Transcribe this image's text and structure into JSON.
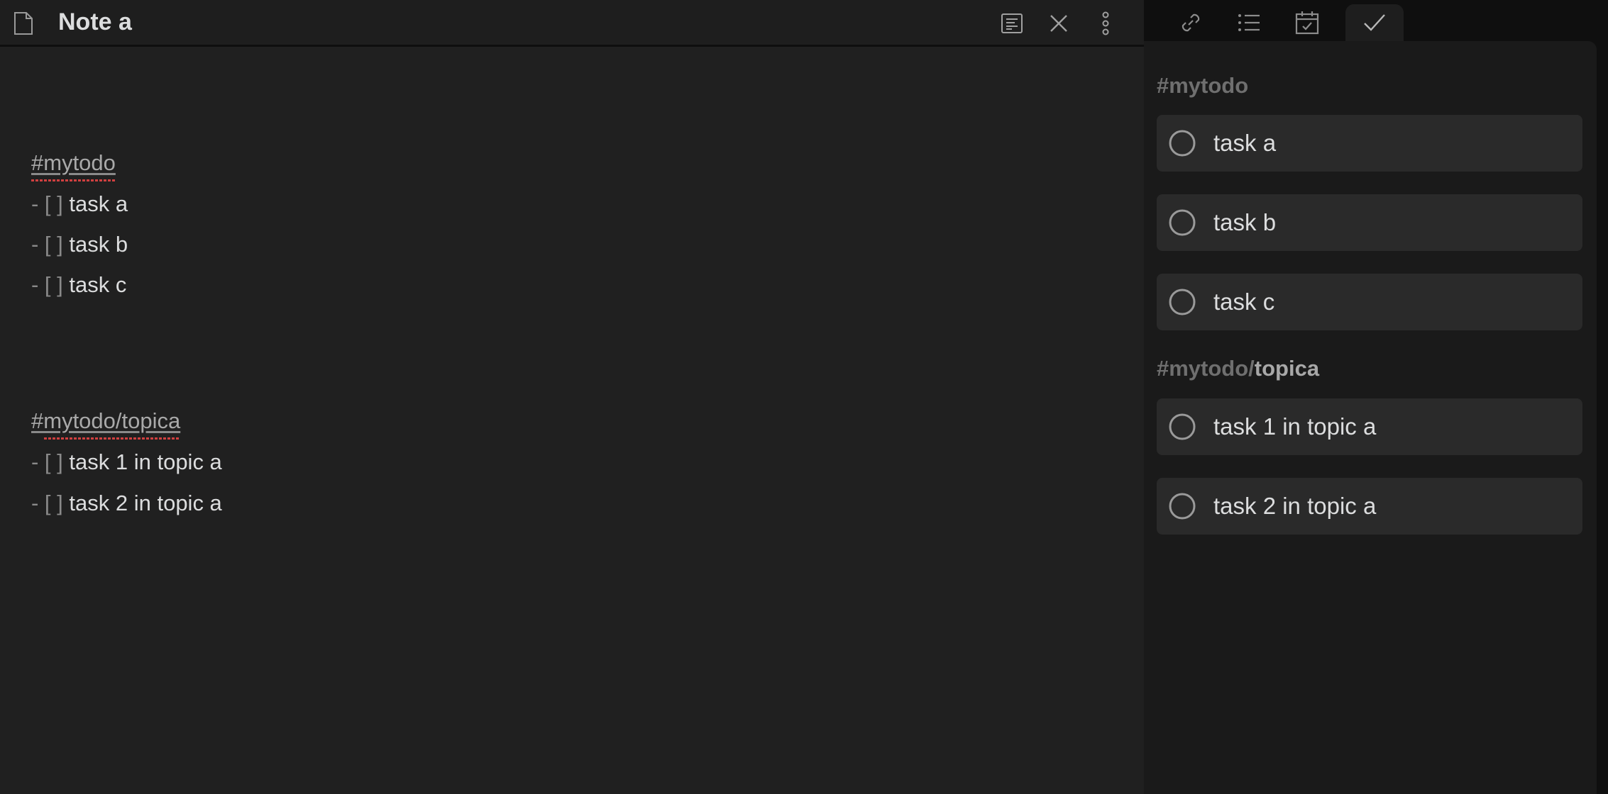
{
  "colors": {
    "editor_bg": "#202020",
    "sidebar_bg": "#1a1a1a",
    "card_bg": "#2a2a2a",
    "text": "#dcddde",
    "muted_text": "#a9a9a9",
    "heading_muted": "#6f6f6f",
    "spellcheck": "#d04040"
  },
  "editor": {
    "title": "Note a",
    "icons": {
      "file": "file-icon",
      "reading_view": "reading-view-icon",
      "close": "close-icon",
      "more": "more-vertical-icon"
    },
    "lines": [
      {
        "tag": "#mytodo"
      },
      {
        "marker": "- [ ]",
        "text": "task a"
      },
      {
        "marker": "- [ ]",
        "text": "task b"
      },
      {
        "marker": "- [ ]",
        "text": "task c"
      },
      {
        "tag": "#mytodo/topica"
      },
      {
        "marker": "- [ ]",
        "text": "task 1 in topic a"
      },
      {
        "marker": "- [ ]",
        "text": "task 2 in topic a"
      }
    ]
  },
  "sidebar": {
    "tabs": [
      {
        "icon": "link-icon",
        "active": false
      },
      {
        "icon": "list-icon",
        "active": false
      },
      {
        "icon": "calendar-check-icon",
        "active": false
      },
      {
        "icon": "checkmark-icon",
        "active": true
      }
    ],
    "groups": [
      {
        "prefix": "#mytodo",
        "leaf": "",
        "tasks": [
          {
            "label": "task a",
            "checked": false
          },
          {
            "label": "task b",
            "checked": false
          },
          {
            "label": "task c",
            "checked": false
          }
        ]
      },
      {
        "prefix": "#mytodo/",
        "leaf": "topica",
        "tasks": [
          {
            "label": "task 1 in topic a",
            "checked": false
          },
          {
            "label": "task 2 in topic a",
            "checked": false
          }
        ]
      }
    ]
  }
}
